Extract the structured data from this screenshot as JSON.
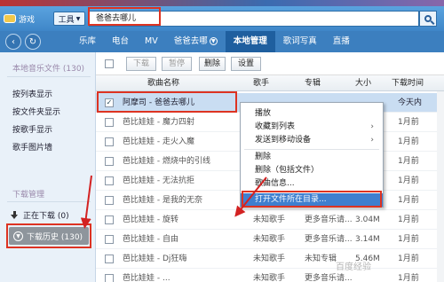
{
  "top": {
    "game_label": "游戏",
    "tool_label": "工具",
    "tool_caret": "▼",
    "search_value": "爸爸去哪儿"
  },
  "nav": {
    "back": "‹",
    "refresh": "↻",
    "tabs": [
      "乐库",
      "电台",
      "MV",
      "爸爸去哪",
      "本地管理",
      "歌词写真",
      "直播"
    ],
    "active_tab": "本地管理"
  },
  "sidebar": {
    "local_header": "本地音乐文件 (130)",
    "items": [
      "按列表显示",
      "按文件夹显示",
      "按歌手显示",
      "歌手图片墙"
    ],
    "download_header": "下载管理",
    "downloading": "正在下载 (0)",
    "download_history": "下载历史 (130)"
  },
  "toolbar": {
    "download": "下载",
    "pause": "暂停",
    "delete": "删除",
    "settings": "设置"
  },
  "table": {
    "headers": {
      "name": "歌曲名称",
      "singer": "歌手",
      "album": "专辑",
      "size": "大小",
      "time": "下载时间"
    },
    "rows": [
      {
        "name": "阿摩司 - 爸爸去哪儿",
        "singer": "",
        "album": "",
        "size": "",
        "time": "今天内",
        "selected": true
      },
      {
        "name": "芭比娃娃 - 魔力四射",
        "singer": "",
        "album": "",
        "size": "",
        "time": "1月前",
        "selected": false
      },
      {
        "name": "芭比娃娃 - 走火入魔",
        "singer": "",
        "album": "",
        "size": "",
        "time": "1月前",
        "selected": false
      },
      {
        "name": "芭比娃娃 - 燃烧中的引线",
        "singer": "",
        "album": "",
        "size": "",
        "time": "1月前",
        "selected": false
      },
      {
        "name": "芭比娃娃 - 无法抗拒",
        "singer": "",
        "album": "",
        "size": "",
        "time": "1月前",
        "selected": false
      },
      {
        "name": "芭比娃娃 - 是我的无奈",
        "singer": "",
        "album": "",
        "size": "",
        "time": "1月前",
        "selected": false
      },
      {
        "name": "芭比娃娃 - 旋转",
        "singer": "未知歌手",
        "album": "更多音乐请...",
        "size": "3.04M",
        "time": "1月前",
        "selected": false
      },
      {
        "name": "芭比娃娃 - 自由",
        "singer": "未知歌手",
        "album": "更多音乐请...",
        "size": "3.14M",
        "time": "1月前",
        "selected": false
      },
      {
        "name": "芭比娃娃 - Dj狂嗨",
        "singer": "未知歌手",
        "album": "未知专辑",
        "size": "5.46M",
        "time": "1月前",
        "selected": false
      },
      {
        "name": "芭比娃娃 - ...",
        "singer": "未知歌手",
        "album": "更多音乐请...",
        "size": "",
        "time": "1月前",
        "selected": false
      }
    ]
  },
  "context_menu": {
    "items": [
      "播放",
      "收藏到列表",
      "发送到移动设备",
      "删除",
      "删除（包括文件）",
      "歌曲信息...",
      "打开文件所在目录..."
    ],
    "submenu_arrow": "›",
    "highlighted": "打开文件所在目录..."
  },
  "watermark": "百度经验",
  "annotation_color": "#d32222"
}
